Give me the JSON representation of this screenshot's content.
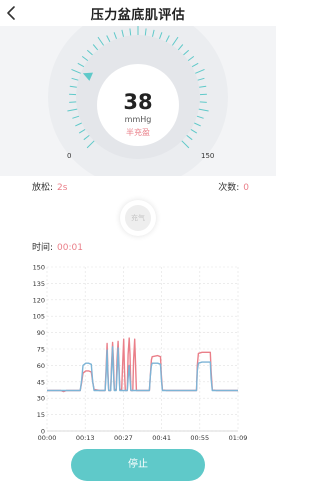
{
  "header": {
    "title": "压力盆底肌评估",
    "back_icon": "chevron-left-icon"
  },
  "gauge": {
    "value": "38",
    "unit": "mmHg",
    "state": "半充盈",
    "min_label": "0",
    "max_label": "150",
    "min": 0,
    "max": 150,
    "current": 38,
    "accent_color": "#5fc9c9",
    "state_color": "#ea7f89"
  },
  "stats": {
    "relax_label": "放松:",
    "relax_value": "2s",
    "count_label": "次数:",
    "count_value": "0"
  },
  "inflate_button": {
    "label": "充气"
  },
  "timer": {
    "label": "时间:",
    "value": "00:01"
  },
  "chart_data": {
    "type": "line",
    "ylim": [
      0,
      150
    ],
    "xlim": [
      0,
      69
    ],
    "y_ticks": [
      "0",
      "15",
      "30",
      "45",
      "60",
      "75",
      "90",
      "105",
      "120",
      "135",
      "150"
    ],
    "x_ticks": [
      "00:00",
      "00:13",
      "00:27",
      "00:41",
      "00:55",
      "01:09"
    ],
    "series": [
      {
        "color": "#ea7f89",
        "points": [
          [
            0,
            37
          ],
          [
            5,
            37
          ],
          [
            6,
            36
          ],
          [
            7,
            37
          ],
          [
            12,
            37
          ],
          [
            12.5,
            44
          ],
          [
            13,
            53
          ],
          [
            14,
            55
          ],
          [
            15,
            55
          ],
          [
            16,
            54
          ],
          [
            16.5,
            45
          ],
          [
            17,
            38
          ],
          [
            19,
            37
          ],
          [
            21,
            37
          ],
          [
            21.3,
            55
          ],
          [
            21.7,
            80
          ],
          [
            22,
            55
          ],
          [
            22.3,
            37
          ],
          [
            23,
            37
          ],
          [
            23.3,
            60
          ],
          [
            23.7,
            81
          ],
          [
            24,
            65
          ],
          [
            24.3,
            38
          ],
          [
            25,
            38
          ],
          [
            25.3,
            65
          ],
          [
            25.7,
            82
          ],
          [
            26,
            60
          ],
          [
            26.3,
            38
          ],
          [
            27,
            38
          ],
          [
            27.3,
            60
          ],
          [
            27.7,
            84
          ],
          [
            28,
            55
          ],
          [
            28.3,
            37
          ],
          [
            29,
            37
          ],
          [
            29.3,
            70
          ],
          [
            29.7,
            85
          ],
          [
            30,
            70
          ],
          [
            30.3,
            37
          ],
          [
            31,
            37
          ],
          [
            31.3,
            65
          ],
          [
            31.7,
            84
          ],
          [
            32,
            60
          ],
          [
            32.3,
            37
          ],
          [
            37,
            37
          ],
          [
            37.3,
            50
          ],
          [
            37.7,
            65
          ],
          [
            38,
            68
          ],
          [
            40,
            69
          ],
          [
            41,
            68
          ],
          [
            41.3,
            52
          ],
          [
            41.7,
            38
          ],
          [
            43,
            37
          ],
          [
            52,
            37
          ],
          [
            53,
            37
          ],
          [
            54,
            37
          ],
          [
            54.3,
            60
          ],
          [
            54.7,
            71
          ],
          [
            56,
            72
          ],
          [
            58,
            72
          ],
          [
            59,
            72
          ],
          [
            59.3,
            55
          ],
          [
            59.7,
            38
          ],
          [
            61,
            37
          ],
          [
            69,
            37
          ]
        ]
      },
      {
        "color": "#7db4d6",
        "points": [
          [
            0,
            37
          ],
          [
            12,
            37
          ],
          [
            12.5,
            46
          ],
          [
            13,
            60
          ],
          [
            14,
            62
          ],
          [
            15,
            62
          ],
          [
            16,
            61
          ],
          [
            16.5,
            45
          ],
          [
            17,
            37
          ],
          [
            21,
            37
          ],
          [
            21.3,
            50
          ],
          [
            21.7,
            74
          ],
          [
            22,
            50
          ],
          [
            22.3,
            37
          ],
          [
            23,
            37
          ],
          [
            23.3,
            55
          ],
          [
            23.7,
            77
          ],
          [
            24,
            55
          ],
          [
            24.3,
            37
          ],
          [
            25,
            37
          ],
          [
            25.3,
            52
          ],
          [
            25.7,
            76
          ],
          [
            26,
            55
          ],
          [
            26.3,
            37
          ],
          [
            29,
            37
          ],
          [
            29.3,
            48
          ],
          [
            29.7,
            60
          ],
          [
            30,
            48
          ],
          [
            30.3,
            37
          ],
          [
            37,
            37
          ],
          [
            37.3,
            50
          ],
          [
            37.7,
            60
          ],
          [
            38,
            62
          ],
          [
            40,
            62
          ],
          [
            41,
            61
          ],
          [
            41.3,
            48
          ],
          [
            41.7,
            37
          ],
          [
            54,
            37
          ],
          [
            54.3,
            55
          ],
          [
            54.7,
            62
          ],
          [
            56,
            63
          ],
          [
            58,
            63
          ],
          [
            59,
            63
          ],
          [
            59.3,
            48
          ],
          [
            59.7,
            37
          ],
          [
            69,
            37
          ]
        ]
      }
    ]
  },
  "stop_button": {
    "label": "停止"
  }
}
